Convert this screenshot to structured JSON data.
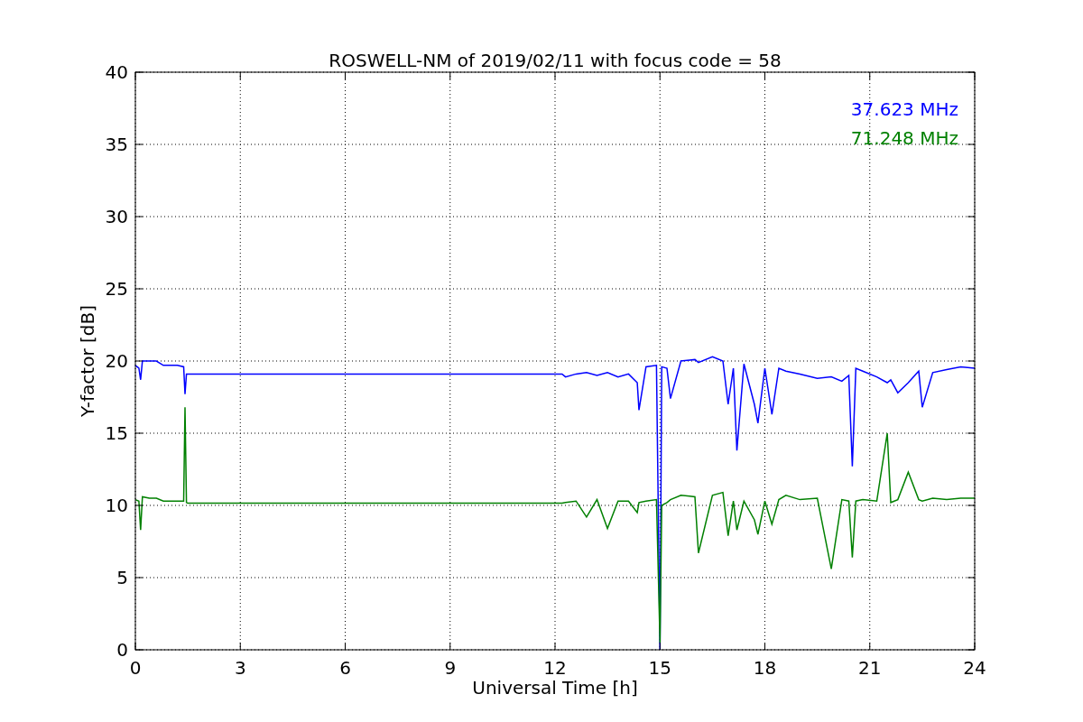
{
  "figure": {
    "chart_data": {
      "type": "line",
      "grid": true,
      "title": "ROSWELL-NM of 2019/02/11 with focus code = 58",
      "xlabel": "Universal Time [h]",
      "ylabel": "Y-factor [dB]",
      "xlim": [
        0,
        24
      ],
      "ylim": [
        0,
        40
      ],
      "xticks": [
        0,
        3,
        6,
        9,
        12,
        15,
        18,
        21,
        24
      ],
      "yticks": [
        0,
        5,
        10,
        15,
        20,
        25,
        30,
        35,
        40
      ],
      "x": [
        0,
        0.1,
        0.15,
        0.2,
        0.4,
        0.6,
        0.8,
        1,
        1.2,
        1.38,
        1.42,
        1.46,
        1.5,
        3,
        6,
        9,
        12.2,
        12.3,
        12.6,
        12.9,
        13.2,
        13.5,
        13.8,
        14.1,
        14.35,
        14.4,
        14.6,
        14.9,
        15,
        15.05,
        15.2,
        15.3,
        15.6,
        16,
        16.1,
        16.5,
        16.8,
        16.95,
        17.1,
        17.2,
        17.4,
        17.7,
        17.8,
        18,
        18.2,
        18.4,
        18.6,
        19,
        19.5,
        19.9,
        20.2,
        20.4,
        20.5,
        20.6,
        20.8,
        21.2,
        21.5,
        21.6,
        21.8,
        22.1,
        22.4,
        22.5,
        22.8,
        23.2,
        23.6,
        24
      ],
      "series": [
        {
          "name": "37.623 MHz",
          "color": "#0000ff",
          "values": [
            19.7,
            19.5,
            18.7,
            20.0,
            20.0,
            20.0,
            19.7,
            19.7,
            19.7,
            19.6,
            17.7,
            19.1,
            19.1,
            19.1,
            19.1,
            19.1,
            19.1,
            18.9,
            19.1,
            19.2,
            19.0,
            19.2,
            18.9,
            19.1,
            18.5,
            16.6,
            19.6,
            19.7,
            0,
            19.6,
            19.5,
            17.4,
            20.0,
            20.1,
            19.9,
            20.3,
            20.0,
            17.0,
            19.5,
            13.8,
            19.8,
            17.0,
            15.7,
            19.5,
            16.3,
            19.5,
            19.3,
            19.1,
            18.8,
            18.9,
            18.6,
            19.0,
            12.7,
            19.5,
            19.3,
            18.9,
            18.5,
            18.7,
            17.8,
            18.5,
            19.3,
            16.8,
            19.2,
            19.4,
            19.6,
            19.5
          ]
        },
        {
          "name": "71.248 MHz",
          "color": "#008000",
          "values": [
            10.4,
            10.3,
            8.3,
            10.6,
            10.5,
            10.5,
            10.3,
            10.3,
            10.3,
            10.3,
            16.8,
            10.2,
            10.15,
            10.15,
            10.15,
            10.15,
            10.15,
            10.2,
            10.3,
            9.2,
            10.4,
            8.4,
            10.3,
            10.3,
            9.5,
            10.2,
            10.3,
            10.4,
            0.5,
            10.0,
            10.2,
            10.4,
            10.7,
            10.6,
            6.7,
            10.7,
            10.9,
            7.9,
            10.3,
            8.3,
            10.3,
            9.0,
            8.0,
            10.3,
            8.7,
            10.4,
            10.7,
            10.4,
            10.5,
            5.6,
            10.4,
            10.3,
            6.4,
            10.3,
            10.4,
            10.3,
            15.0,
            10.2,
            10.4,
            12.3,
            10.4,
            10.3,
            10.5,
            10.4,
            10.5,
            10.5
          ]
        }
      ]
    }
  }
}
